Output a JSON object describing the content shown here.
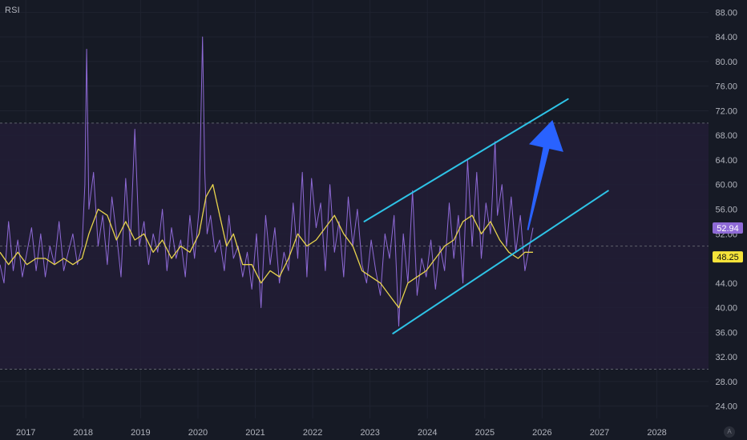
{
  "indicator": {
    "title": "RSI"
  },
  "colors": {
    "background": "#161a25",
    "band_fill": "#221d36",
    "band_line": "#5d606b",
    "grid": "#1f2330",
    "rsi": "#8e6ad6",
    "rsi_ma": "#e8d44d",
    "channel": "#2ec3e6",
    "arrow": "#2962ff",
    "rsi_badge": "#8e6ad6",
    "ma_badge": "#f5e33a"
  },
  "chart_data": {
    "type": "line",
    "ylim": [
      22,
      90
    ],
    "xlim": [
      2016.55,
      2028.9
    ],
    "y_ticks": [
      24,
      28,
      32,
      36,
      40,
      44,
      48,
      52,
      56,
      60,
      64,
      68,
      72,
      76,
      80,
      84,
      88
    ],
    "y_tick_labels": [
      "24.00",
      "28.00",
      "32.00",
      "36.00",
      "40.00",
      "44.00",
      "48.00",
      "52.00",
      "56.00",
      "60.00",
      "64.00",
      "68.00",
      "72.00",
      "76.00",
      "80.00",
      "84.00",
      "88.00"
    ],
    "x_ticks": [
      2017,
      2018,
      2019,
      2020,
      2021,
      2022,
      2023,
      2024,
      2025,
      2026,
      2027,
      2028
    ],
    "x_tick_labels": [
      "2017",
      "2018",
      "2019",
      "2020",
      "2021",
      "2022",
      "2023",
      "2024",
      "2025",
      "2026",
      "2027",
      "2028"
    ],
    "bands": {
      "upper": 70,
      "middle": 50,
      "lower": 30
    },
    "series": [
      {
        "values_x": [
          2016.55,
          2016.62,
          2016.7,
          2016.78,
          2016.86,
          2016.94,
          2017.02,
          2017.1,
          2017.18,
          2017.26,
          2017.34,
          2017.42,
          2017.5,
          2017.58,
          2017.66,
          2017.74,
          2017.82,
          2017.9,
          2017.98,
          2018.03,
          2018.06,
          2018.1,
          2018.18,
          2018.26,
          2018.34,
          2018.42,
          2018.5,
          2018.58,
          2018.66,
          2018.74,
          2018.82,
          2018.9,
          2018.98,
          2019.06,
          2019.14,
          2019.22,
          2019.3,
          2019.38,
          2019.46,
          2019.54,
          2019.62,
          2019.7,
          2019.78,
          2019.86,
          2019.94,
          2020.02,
          2020.08,
          2020.12,
          2020.16,
          2020.22,
          2020.3,
          2020.38,
          2020.46,
          2020.54,
          2020.62,
          2020.7,
          2020.78,
          2020.86,
          2020.94,
          2021.02,
          2021.1,
          2021.18,
          2021.26,
          2021.34,
          2021.42,
          2021.5,
          2021.58,
          2021.66,
          2021.74,
          2021.82,
          2021.9,
          2021.98,
          2022.06,
          2022.14,
          2022.22,
          2022.3,
          2022.38,
          2022.46,
          2022.54,
          2022.62,
          2022.7,
          2022.78,
          2022.86,
          2022.94,
          2023.02,
          2023.1,
          2023.18,
          2023.26,
          2023.34,
          2023.42,
          2023.5,
          2023.58,
          2023.66,
          2023.74,
          2023.82,
          2023.9,
          2023.98,
          2024.06,
          2024.14,
          2024.22,
          2024.3,
          2024.38,
          2024.46,
          2024.54,
          2024.62,
          2024.7,
          2024.78,
          2024.86,
          2024.94,
          2025.02,
          2025.1,
          2025.18,
          2025.22,
          2025.3,
          2025.38,
          2025.46,
          2025.54,
          2025.62,
          2025.7,
          2025.78,
          2025.84
        ],
        "values": [
          47,
          44,
          54,
          46,
          51,
          45,
          49,
          53,
          46,
          52,
          45,
          50,
          47,
          54,
          46,
          49,
          52,
          47,
          50,
          60,
          82,
          56,
          62,
          50,
          55,
          47,
          58,
          52,
          45,
          61,
          50,
          69,
          50,
          54,
          47,
          52,
          49,
          56,
          46,
          53,
          48,
          51,
          45,
          55,
          48,
          56,
          84,
          62,
          52,
          55,
          49,
          51,
          46,
          55,
          48,
          50,
          45,
          49,
          43,
          52,
          40,
          55,
          47,
          53,
          44,
          49,
          46,
          57,
          48,
          62,
          45,
          61,
          53,
          57,
          46,
          60,
          49,
          54,
          45,
          58,
          50,
          56,
          47,
          44,
          51,
          46,
          42,
          52,
          48,
          55,
          37,
          52,
          44,
          59,
          42,
          48,
          45,
          51,
          43,
          50,
          46,
          57,
          48,
          55,
          44,
          64,
          50,
          62,
          48,
          57,
          52,
          67,
          55,
          60,
          50,
          58,
          49,
          55,
          46,
          50,
          53
        ],
        "last_value": 52.94,
        "last_label": "52.94"
      },
      {
        "values_x": [
          2016.55,
          2016.7,
          2016.86,
          2017.02,
          2017.18,
          2017.34,
          2017.5,
          2017.66,
          2017.82,
          2017.98,
          2018.1,
          2018.26,
          2018.42,
          2018.58,
          2018.74,
          2018.9,
          2019.06,
          2019.22,
          2019.38,
          2019.54,
          2019.7,
          2019.86,
          2020.02,
          2020.14,
          2020.26,
          2020.38,
          2020.5,
          2020.62,
          2020.78,
          2020.94,
          2021.1,
          2021.26,
          2021.42,
          2021.58,
          2021.74,
          2021.9,
          2022.06,
          2022.22,
          2022.38,
          2022.54,
          2022.7,
          2022.86,
          2023.02,
          2023.18,
          2023.34,
          2023.5,
          2023.66,
          2023.82,
          2023.98,
          2024.14,
          2024.3,
          2024.46,
          2024.62,
          2024.78,
          2024.94,
          2025.1,
          2025.26,
          2025.42,
          2025.58,
          2025.7,
          2025.78,
          2025.84
        ],
        "values": [
          49,
          47,
          49,
          47,
          48,
          48,
          47,
          48,
          47,
          48,
          52,
          56,
          55,
          51,
          54,
          51,
          52,
          49,
          51,
          48,
          50,
          49,
          52,
          58,
          60,
          55,
          50,
          52,
          47,
          47,
          44,
          46,
          45,
          48,
          52,
          50,
          51,
          53,
          55,
          52,
          50,
          46,
          45,
          44,
          42,
          40,
          44,
          45,
          46,
          48,
          50,
          51,
          54,
          55,
          52,
          54,
          51,
          49,
          48,
          49,
          49,
          49
        ],
        "last_value": 48.25,
        "last_label": "48.25"
      }
    ],
    "annotations": {
      "channel_upper": [
        [
          2022.9,
          54
        ],
        [
          2026.45,
          73.9
        ]
      ],
      "channel_lower": [
        [
          2023.4,
          35.8
        ],
        [
          2027.15,
          59
        ]
      ],
      "arrow_tail": [
        2025.75,
        52.6
      ],
      "arrow_head": [
        2026.18,
        70.5
      ]
    }
  }
}
